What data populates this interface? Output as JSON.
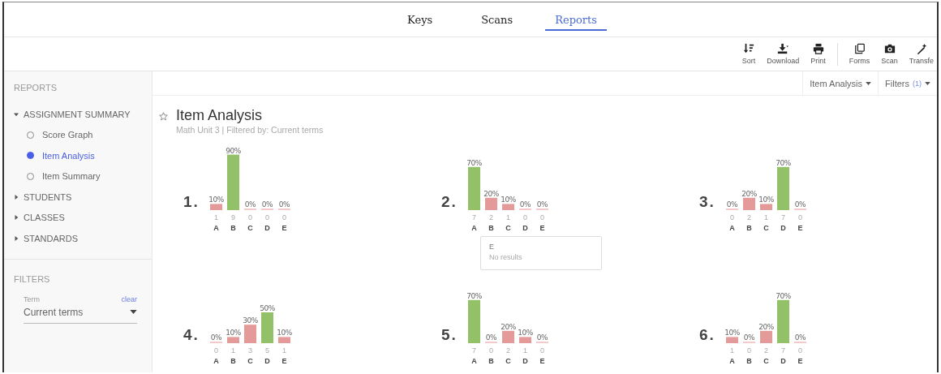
{
  "nav_tabs": [
    {
      "label": "Keys",
      "selected": false
    },
    {
      "label": "Scans",
      "selected": false
    },
    {
      "label": "Reports",
      "selected": true
    }
  ],
  "toolbar": [
    {
      "label": "Sort",
      "kind": "sort"
    },
    {
      "label": "Download",
      "kind": "download"
    },
    {
      "label": "Print",
      "kind": "print"
    },
    {
      "label": "Forms",
      "kind": "forms"
    },
    {
      "label": "Scan",
      "kind": "scan"
    },
    {
      "label": "Transfe",
      "kind": "wand"
    }
  ],
  "sidebar": {
    "heading": "REPORTS",
    "tree": [
      {
        "label": "ASSIGNMENT SUMMARY",
        "expanded": true,
        "children": [
          {
            "label": "Score Graph",
            "selected": false
          },
          {
            "label": "Item Analysis",
            "selected": true
          },
          {
            "label": "Item Summary",
            "selected": false
          }
        ]
      },
      {
        "label": "STUDENTS",
        "expanded": false
      },
      {
        "label": "CLASSES",
        "expanded": false
      },
      {
        "label": "STANDARDS",
        "expanded": false
      }
    ],
    "filters": {
      "heading": "FILTERS",
      "term_label": "Term",
      "clear_link": "clear",
      "term_value": "Current terms"
    }
  },
  "header_bar": {
    "report_menu": "Item Analysis",
    "filters_menu": "Filters",
    "filters_count": "(1)"
  },
  "report": {
    "title": "Item Analysis",
    "favorite": false,
    "subtitle": "Math Unit 3 | Filtered by: Current terms"
  },
  "items": [
    {
      "number": "1.",
      "counts": [
        "1",
        "9",
        "0",
        "0",
        "0"
      ],
      "correct": [
        false,
        true,
        false,
        false,
        false
      ],
      "chart_data": {
        "type": "bar",
        "categories": [
          "A",
          "B",
          "C",
          "D",
          "E"
        ],
        "values": [
          10,
          90,
          0,
          0,
          0
        ],
        "value_labels": [
          "10%",
          "90%",
          "0%",
          "0%",
          "0%"
        ]
      }
    },
    {
      "number": "2.",
      "counts": [
        "7",
        "2",
        "1",
        "0",
        "0"
      ],
      "correct": [
        true,
        false,
        false,
        false,
        false
      ],
      "chart_data": {
        "type": "bar",
        "categories": [
          "A",
          "B",
          "C",
          "D",
          "E"
        ],
        "values": [
          70,
          20,
          10,
          0,
          0
        ],
        "value_labels": [
          "70%",
          "20%",
          "10%",
          "0%",
          "0%"
        ]
      },
      "tooltip": {
        "title": "E",
        "text": "No results"
      }
    },
    {
      "number": "3.",
      "counts": [
        "0",
        "2",
        "1",
        "7",
        "0"
      ],
      "correct": [
        false,
        false,
        false,
        true,
        false
      ],
      "chart_data": {
        "type": "bar",
        "categories": [
          "A",
          "B",
          "C",
          "D",
          "E"
        ],
        "values": [
          0,
          20,
          10,
          70,
          0
        ],
        "value_labels": [
          "0%",
          "20%",
          "10%",
          "70%",
          "0%"
        ]
      }
    },
    {
      "number": "4.",
      "counts": [
        "0",
        "1",
        "3",
        "5",
        "1"
      ],
      "correct": [
        false,
        false,
        false,
        true,
        false
      ],
      "chart_data": {
        "type": "bar",
        "categories": [
          "A",
          "B",
          "C",
          "D",
          "E"
        ],
        "values": [
          0,
          10,
          30,
          50,
          10
        ],
        "value_labels": [
          "0%",
          "10%",
          "30%",
          "50%",
          "10%"
        ]
      }
    },
    {
      "number": "5.",
      "counts": [
        "7",
        "0",
        "2",
        "1",
        "0"
      ],
      "correct": [
        true,
        false,
        false,
        false,
        false
      ],
      "chart_data": {
        "type": "bar",
        "categories": [
          "A",
          "B",
          "C",
          "D",
          "E"
        ],
        "values": [
          70,
          0,
          20,
          10,
          0
        ],
        "value_labels": [
          "70%",
          "0%",
          "20%",
          "10%",
          "0%"
        ]
      }
    },
    {
      "number": "6.",
      "counts": [
        "1",
        "0",
        "2",
        "7",
        "0"
      ],
      "correct": [
        false,
        false,
        false,
        true,
        false
      ],
      "chart_data": {
        "type": "bar",
        "categories": [
          "A",
          "B",
          "C",
          "D",
          "E"
        ],
        "values": [
          10,
          0,
          20,
          70,
          0
        ],
        "value_labels": [
          "10%",
          "0%",
          "20%",
          "70%",
          "0%"
        ]
      }
    }
  ]
}
